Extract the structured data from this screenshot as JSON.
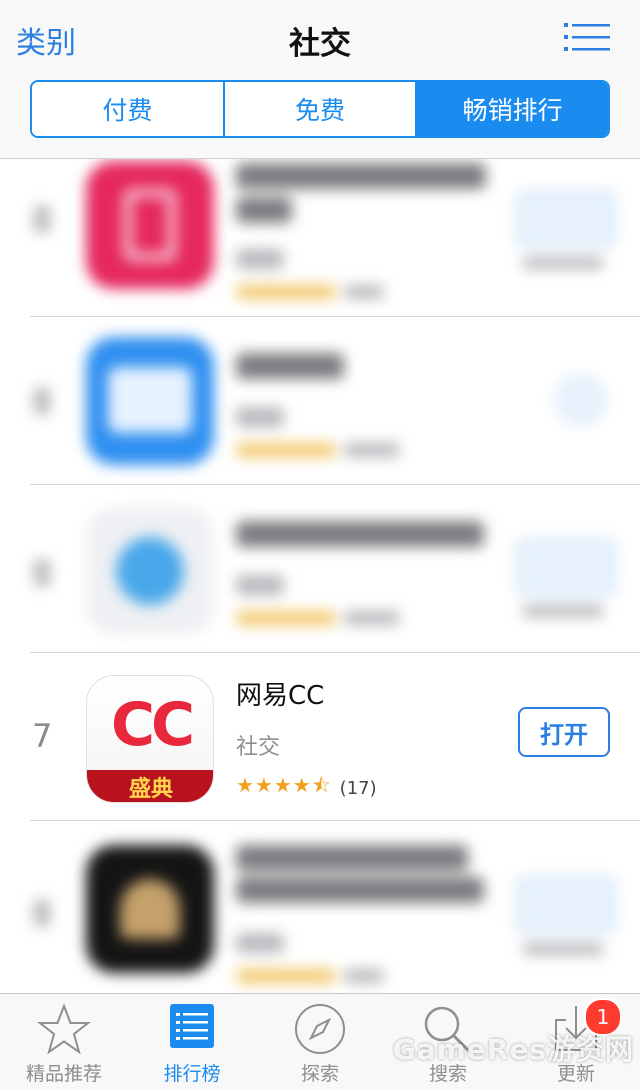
{
  "nav": {
    "back_label": "类别",
    "title": "社交",
    "list_icon": "list-icon"
  },
  "segments": [
    {
      "label": "付费",
      "active": false
    },
    {
      "label": "免费",
      "active": false
    },
    {
      "label": "畅销排行",
      "active": true
    }
  ],
  "featured_app": {
    "rank": "7",
    "name": "网易CC",
    "category": "社交",
    "stars": "★★★★⯪",
    "rating": 4.5,
    "rating_count": "(17)",
    "action_label": "打开",
    "icon_text": "CC",
    "icon_banner": "盛典",
    "colors": {
      "icon_text": "#e8283c",
      "banner": "#b8121e"
    }
  },
  "tabbar": {
    "items": [
      {
        "label": "精品推荐",
        "icon": "star-icon",
        "active": false
      },
      {
        "label": "排行榜",
        "icon": "ranking-list-icon",
        "active": true
      },
      {
        "label": "探索",
        "icon": "compass-icon",
        "active": false
      },
      {
        "label": "搜索",
        "icon": "search-icon",
        "active": false
      },
      {
        "label": "更新",
        "icon": "download-icon",
        "active": false,
        "badge": "1"
      }
    ]
  },
  "watermark": "GameRes游资网",
  "colors": {
    "accent": "#1a8cf0",
    "badge": "#ff3b30",
    "star": "#f0a020"
  }
}
